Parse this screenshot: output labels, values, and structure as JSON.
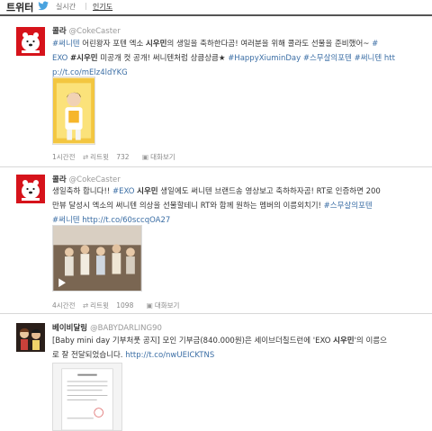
{
  "header": {
    "title": "트위터",
    "tab_realtime": "실시간",
    "tab_popular": "인기도"
  },
  "tweets": [
    {
      "name": "콜라",
      "handle": "@CokeCaster",
      "lines": [
        [
          [
            "h",
            "#써니텐"
          ],
          [
            "t",
            " 어린왕자 포텐 엑소 "
          ],
          [
            "b",
            "시우민"
          ],
          [
            "t",
            "의 생일을 축하한다곰! 여러분을 위해 콜라도 선물을 준비했어~ "
          ],
          [
            "h",
            "#"
          ]
        ],
        [
          [
            "h",
            "EXO"
          ],
          [
            "t",
            " "
          ],
          [
            "b",
            "#시우민"
          ],
          [
            "t",
            " 미공개 컷 공개! 써니텐처럼 상큼상큼★ "
          ],
          [
            "h",
            "#HappyXiuminDay"
          ],
          [
            "t",
            " "
          ],
          [
            "h",
            "#스무살의포텐"
          ],
          [
            "t",
            " "
          ],
          [
            "h",
            "#써니텐"
          ],
          [
            "t",
            " "
          ],
          [
            "h",
            "htt"
          ]
        ],
        [
          [
            "h",
            "p://t.co/mElz4ldYKG"
          ]
        ]
      ],
      "time": "1시간전",
      "retweet_label": "리트윗",
      "retweet_count": "732",
      "reply_label": "대화보기"
    },
    {
      "name": "콜라",
      "handle": "@CokeCaster",
      "lines": [
        [
          [
            "t",
            "생일축하 합니다!! "
          ],
          [
            "h",
            "#EXO"
          ],
          [
            "t",
            " "
          ],
          [
            "b",
            "시우민"
          ],
          [
            "t",
            " 생일에도 써니텐 브랜드송 영상보고 축하하자곰! RT로 인증하면 200"
          ]
        ],
        [
          [
            "t",
            "만뷰 달성시 엑소의 써니텐 의상을 선물할테니 RT와 함께 원하는 멤버의 이름외치기! "
          ],
          [
            "h",
            "#스무살의포텐"
          ]
        ],
        [
          [
            "h",
            "#써니텐"
          ],
          [
            "t",
            " "
          ],
          [
            "h",
            "http://t.co/60sccqOA27"
          ]
        ]
      ],
      "time": "4시간전",
      "retweet_label": "리트윗",
      "retweet_count": "1098",
      "reply_label": "대화보기"
    },
    {
      "name": "베이비달링",
      "handle": "@BABYDARLING90",
      "lines": [
        [
          [
            "t",
            "[Baby mini day 기부처풋 공지] 모인 기부금(840.000원)은 세이브더칠드런에 'EXO "
          ],
          [
            "b",
            "시우민"
          ],
          [
            "t",
            "'의 이름으"
          ]
        ],
        [
          [
            "t",
            "로 잘 전달되었습니다. "
          ],
          [
            "h",
            "http://t.co/nwUEICKTNS"
          ]
        ]
      ]
    }
  ],
  "colors": {
    "link": "#3b6ea5",
    "coke_red": "#d6131b",
    "muted": "#999999"
  }
}
